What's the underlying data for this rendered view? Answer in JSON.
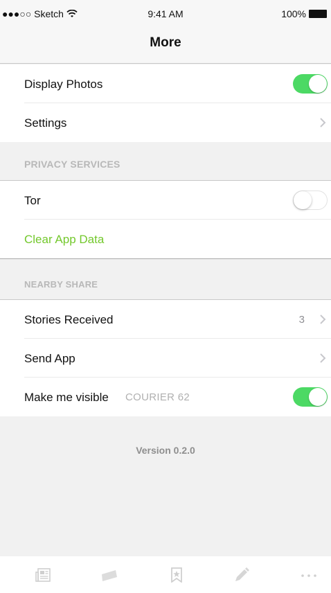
{
  "status_bar": {
    "carrier": "●●●○○ Sketch",
    "time": "9:41 AM",
    "battery": "100%"
  },
  "nav": {
    "title": "More"
  },
  "general": {
    "display_photos": {
      "label": "Display Photos",
      "enabled": true
    },
    "settings": {
      "label": "Settings"
    }
  },
  "privacy": {
    "header": "PRIVACY SERVICES",
    "tor": {
      "label": "Tor",
      "enabled": false
    },
    "clear_app_data": {
      "label": "Clear App Data",
      "color": "#73c82c"
    }
  },
  "nearby": {
    "header": "NEARBY SHARE",
    "stories_received": {
      "label": "Stories Received",
      "count": "3"
    },
    "send_app": {
      "label": "Send App"
    },
    "make_visible": {
      "label": "Make me visible",
      "device_name": "COURIER 62",
      "enabled": true
    }
  },
  "version": "Version 0.2.0",
  "tab_bar": {
    "items": [
      "newspaper-icon",
      "flag-icon",
      "bookmark-star-icon",
      "pencil-icon",
      "more-icon"
    ]
  },
  "colors": {
    "toggle_on": "#4cd964",
    "accent": "#73c82c"
  }
}
